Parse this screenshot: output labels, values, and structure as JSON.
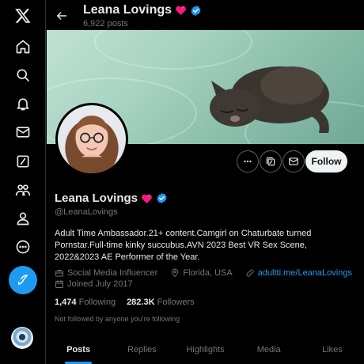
{
  "nav": {
    "items": [
      {
        "name": "x-logo-icon"
      },
      {
        "name": "home-icon"
      },
      {
        "name": "search-icon"
      },
      {
        "name": "notifications-icon"
      },
      {
        "name": "messages-icon"
      },
      {
        "name": "grok-icon"
      },
      {
        "name": "communities-icon"
      },
      {
        "name": "profile-icon"
      },
      {
        "name": "more-icon"
      },
      {
        "name": "compose-post-icon"
      }
    ]
  },
  "header": {
    "name": "Leana Lovings",
    "posts_count": "6,922 posts"
  },
  "profile": {
    "name": "Leana Lovings",
    "handle": "@LeanaLovings",
    "bio": "Adult Time Ambassador.21+ content.Camgirl on Chaturbate turned Pornstar.Full-time kinky succubus.AVN 2023 Best VR Sex Scene, 2022&2023 AE Performer of the Year.",
    "category": "Social Media Influencer",
    "location": "Florida, USA",
    "website": "adultti.me/LeanaLovings",
    "joined": "Joined July 2017",
    "following_count": "1,474",
    "following_label": "Following",
    "followers_count": "282.3K",
    "followers_label": "Followers",
    "not_followed_note": "Not followed by anyone you’re following"
  },
  "actions": {
    "follow_label": "Follow"
  },
  "tabs": [
    {
      "label": "Posts",
      "active": true
    },
    {
      "label": "Replies",
      "active": false
    },
    {
      "label": "Highlights",
      "active": false
    },
    {
      "label": "Media",
      "active": false
    },
    {
      "label": "Likes",
      "active": false
    }
  ],
  "colors": {
    "background": "#000000",
    "accent": "#1d9bf0",
    "heart": "#f91880",
    "muted_text": "#71767b"
  }
}
